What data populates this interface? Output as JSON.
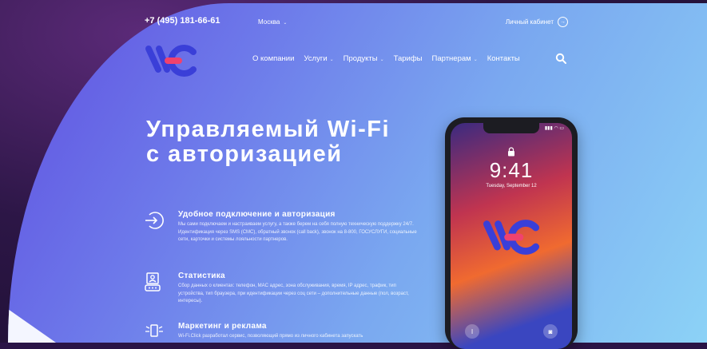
{
  "header": {
    "phone": "+7 (495) 181-66-61",
    "city": "Москва",
    "account_label": "Личный кабинет"
  },
  "nav": {
    "items": [
      {
        "label": "О компании",
        "dropdown": false
      },
      {
        "label": "Услуги",
        "dropdown": true
      },
      {
        "label": "Продукты",
        "dropdown": true
      },
      {
        "label": "Тарифы",
        "dropdown": false
      },
      {
        "label": "Партнерам",
        "dropdown": true
      },
      {
        "label": "Контакты",
        "dropdown": false
      }
    ]
  },
  "hero": {
    "title_line1": "Управляемый Wi-Fi",
    "title_line2": "с авторизацией"
  },
  "features": [
    {
      "icon": "login-arrow-icon",
      "title": "Удобное подключение и авторизация",
      "text": "Мы сами подключаем и настраиваем услугу, а также берем на себя полную техническую поддержку 24/7. Идентификация через SMS (СМС), обратный звонок (call back), звонок на 8-800, ГОСУСЛУГИ, социальные сети, карточки и системы лояльности партнеров."
    },
    {
      "icon": "statistics-icon",
      "title": "Статистика",
      "text": "Сбор данных о клиентах: телефон, MAC адрес, зона обслуживания, время, IP адрес, трафик, тип устройства, тип браузера, при идентификации через соц сети – дополнительные данные (пол, возраст, интересы)."
    },
    {
      "icon": "marketing-icon",
      "title": "Маркетинг и реклама",
      "text": "Wi-Fi.Click разработал сервис, позволяющий прямо из личного кабинета запускать"
    }
  ],
  "phone_mockup": {
    "time": "9:41",
    "date": "Tuesday, September 12"
  },
  "colors": {
    "logo_blue": "#3a3fd8",
    "logo_pink": "#f0426e",
    "gradient_start": "#5f4fe0",
    "gradient_end": "#8cd2f6"
  }
}
